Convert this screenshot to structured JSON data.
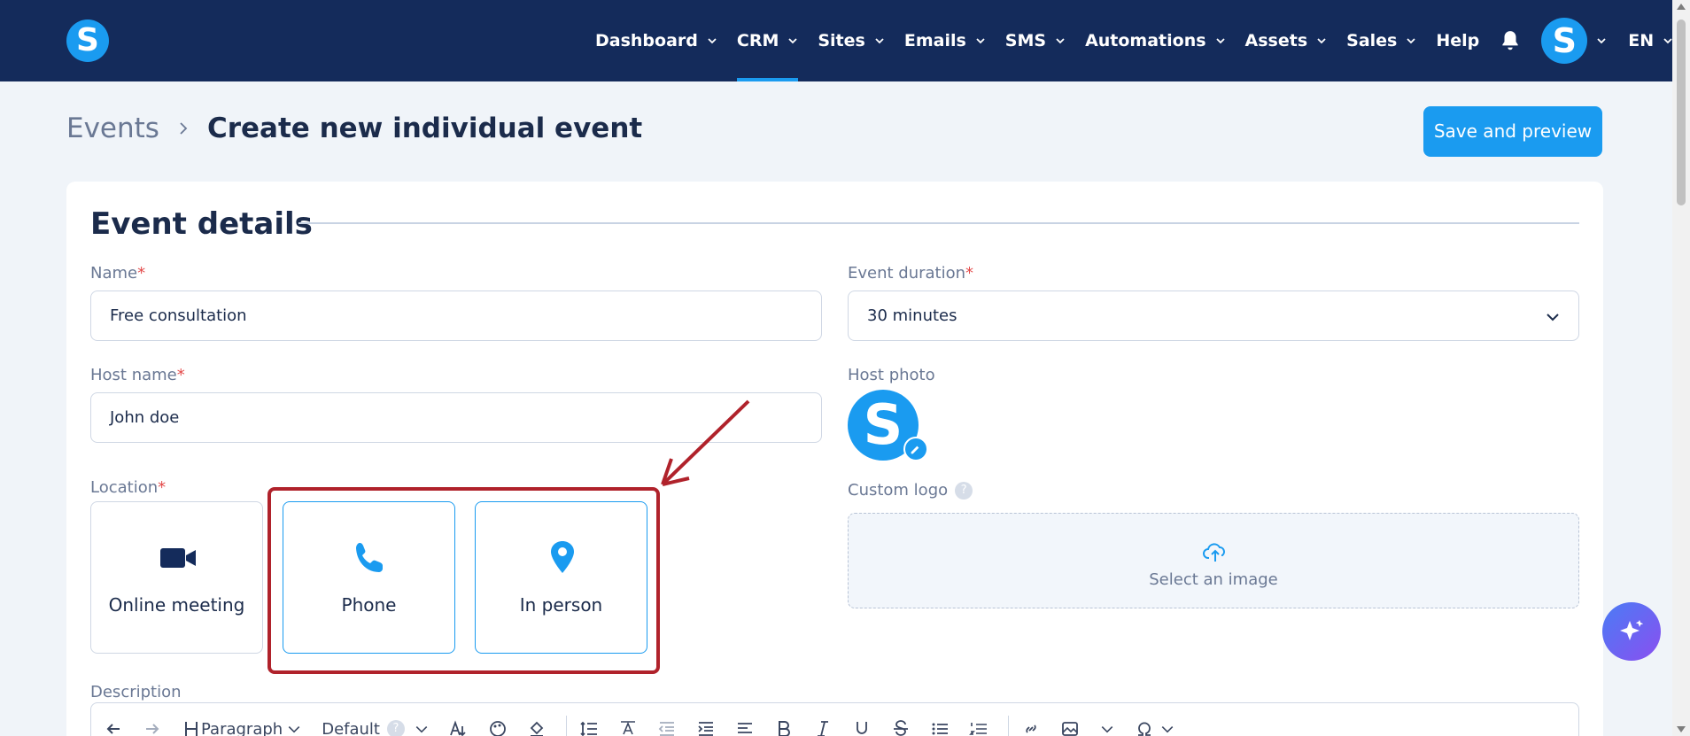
{
  "nav": {
    "logo": "S",
    "items": [
      {
        "label": "Dashboard",
        "has_dropdown": true,
        "active": false
      },
      {
        "label": "CRM",
        "has_dropdown": true,
        "active": true
      },
      {
        "label": "Sites",
        "has_dropdown": true,
        "active": false
      },
      {
        "label": "Emails",
        "has_dropdown": true,
        "active": false
      },
      {
        "label": "SMS",
        "has_dropdown": true,
        "active": false
      },
      {
        "label": "Automations",
        "has_dropdown": true,
        "active": false
      },
      {
        "label": "Assets",
        "has_dropdown": true,
        "active": false
      },
      {
        "label": "Sales",
        "has_dropdown": true,
        "active": false
      },
      {
        "label": "Help",
        "has_dropdown": false,
        "active": false
      }
    ],
    "avatar_letter": "S",
    "language": "EN"
  },
  "breadcrumb": {
    "parent": "Events",
    "current": "Create new individual event"
  },
  "save_button": "Save and preview",
  "section": {
    "title": "Event details"
  },
  "fields": {
    "name_label": "Name",
    "name_value": "Free consultation",
    "duration_label": "Event duration",
    "duration_value": "30 minutes",
    "host_name_label": "Host name",
    "host_name_value": "John doe",
    "host_photo_label": "Host photo",
    "host_photo_letter": "S",
    "location_label": "Location",
    "custom_logo_label": "Custom logo",
    "custom_logo_help": "?",
    "upload_label": "Select an image",
    "description_label": "Description",
    "required_mark": "*"
  },
  "locations": [
    {
      "label": "Online meeting",
      "icon": "video-camera-icon"
    },
    {
      "label": "Phone",
      "icon": "phone-icon"
    },
    {
      "label": "In person",
      "icon": "map-pin-icon"
    }
  ],
  "toolbar": {
    "paragraph": "Paragraph",
    "font": "Default",
    "font_help": "?"
  },
  "colors": {
    "nav_bg": "#142b5b",
    "accent": "#1a9bf0",
    "highlight": "#b0222b",
    "text_dark": "#1b2b4b",
    "text_muted": "#6a7894"
  }
}
